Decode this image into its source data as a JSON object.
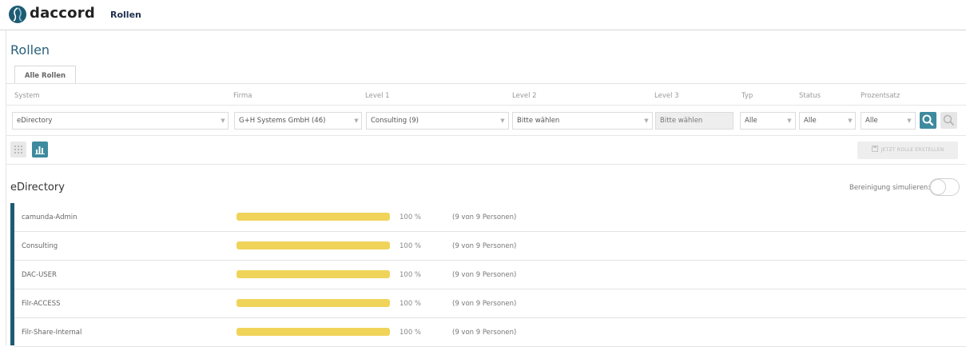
{
  "header": {
    "logo_text": "daccord",
    "nav_item": "Rollen"
  },
  "page": {
    "title": "Rollen",
    "tab": "Alle Rollen"
  },
  "filters": {
    "labels": {
      "system": "System",
      "firma": "Firma",
      "level1": "Level 1",
      "level2": "Level 2",
      "level3": "Level 3",
      "typ": "Typ",
      "status": "Status",
      "prozentsatz": "Prozentsatz"
    },
    "values": {
      "system": "eDirectory",
      "firma": "G+H Systems GmbH (46)",
      "level1": "Consulting (9)",
      "level2": "Bitte wählen",
      "level3": "Bitte wählen",
      "typ": "Alle",
      "status": "Alle",
      "prozentsatz": "Alle"
    }
  },
  "toolbar": {
    "create_role_label": "JETZT ROLLE ERSTELLEN"
  },
  "section": {
    "title": "eDirectory",
    "simulate_label": "Bereinigung simulieren:",
    "simulate_on": false
  },
  "roles": [
    {
      "name": "camunda-Admin",
      "percent": 100,
      "percent_label": "100 %",
      "count_label": "(9 von 9 Personen)"
    },
    {
      "name": "Consulting",
      "percent": 100,
      "percent_label": "100 %",
      "count_label": "(9 von 9 Personen)"
    },
    {
      "name": "DAC-USER",
      "percent": 100,
      "percent_label": "100 %",
      "count_label": "(9 von 9 Personen)"
    },
    {
      "name": "Filr-ACCESS",
      "percent": 100,
      "percent_label": "100 %",
      "count_label": "(9 von 9 Personen)"
    },
    {
      "name": "Filr-Share-Internal",
      "percent": 100,
      "percent_label": "100 %",
      "count_label": "(9 von 9 Personen)"
    }
  ],
  "colors": {
    "primary": "#1e5b73",
    "button": "#3e8a9e",
    "bar": "#f0d45a"
  },
  "icons": {
    "search": "search-icon",
    "search_reset": "search-reset-icon",
    "grid_view": "grid-view-icon",
    "chart_view": "bar-chart-icon",
    "create": "save-icon",
    "dropdown": "chevron-down-icon"
  }
}
